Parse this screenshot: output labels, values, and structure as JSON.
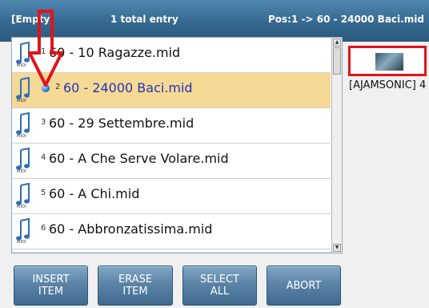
{
  "header": {
    "left": "[Empty]",
    "center": "1 total entry",
    "right": "Pos:1 -> 60 - 24000 Baci.mid"
  },
  "file_icon_label": "MIDI",
  "rows": [
    {
      "index": "1",
      "name": "60 - 10 Ragazze.mid",
      "selected": false
    },
    {
      "index": "2",
      "name": "60 - 24000 Baci.mid",
      "selected": true
    },
    {
      "index": "3",
      "name": "60 - 29 Settembre.mid",
      "selected": false
    },
    {
      "index": "4",
      "name": "60 - A Che Serve Volare.mid",
      "selected": false
    },
    {
      "index": "5",
      "name": "60 - A Chi.mid",
      "selected": false
    },
    {
      "index": "6",
      "name": "60 - Abbronzatissima.mid",
      "selected": false
    }
  ],
  "preview": {
    "label": "[AJAMSONIC] 4"
  },
  "buttons": {
    "insert": "INSERT\nITEM",
    "erase": "ERASE\nITEM",
    "select_all": "SELECT\nALL",
    "abort": "ABORT"
  },
  "colors": {
    "header": "#35688f",
    "selected_row": "#f7d996",
    "selected_text": "#2333b5",
    "annotation_red": "#e0141b",
    "button": "#5b84a7"
  }
}
